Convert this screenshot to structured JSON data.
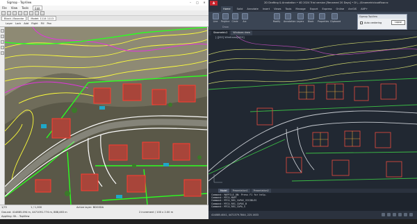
{
  "left_window": {
    "title": "Sigmap - TopView",
    "controls": [
      "–",
      "□",
      "✕"
    ],
    "menu": [
      "File",
      "View",
      "Tools"
    ],
    "menu_search": "Edit",
    "tabs": [
      "Block / Boundar",
      "Model: 1114 1113"
    ],
    "options": [
      "Layer",
      "Lock",
      "Add",
      "Right",
      "Fill",
      "Pan"
    ],
    "status_line1": "Ground: 414885.494 m, 4471091.774 m, 888,463 m",
    "status_line2": "Appliing: SIL - TopView",
    "scale_left": "1/72",
    "scale_right": "1 / 1,000",
    "layer_info": "Active layer: BDGSDA",
    "increment": "2 increment / 100 x 2.00 m"
  },
  "right_window": {
    "logo": "A",
    "title": "2D Drafting & Annotation  •  4D 2024 Trial version [Renamed 20 Days]  •  D:\\...\\Sinametricloudflow.nc",
    "ribbon_tabs": [
      "Home",
      "Solid",
      "Annotate",
      "Insert",
      "Views",
      "Tools",
      "Manage",
      "Export",
      "Express",
      "Online",
      "ArcGIS",
      "AXP+"
    ],
    "active_tab": "Home",
    "ribbon_items": [
      "Line",
      "Polyline",
      "Circle",
      "Arc",
      "Modify",
      "Annotation",
      "Layers",
      "Block",
      "Properties",
      "Clipboard"
    ],
    "ribbon_groups": [
      "Draw",
      "Properties"
    ],
    "dialog_title": "Sigmap TopView",
    "dialog_checkbox": "Auto centering",
    "dialog_button": "Lapse",
    "doc_tabs": [
      "Sinametric2",
      "Windows draw"
    ],
    "active_doc": "Sinametric2",
    "viewport_label": "[-][ISO] Wireframe[WCS]",
    "layout_tabs": [
      "Model",
      "Presentation1",
      "Presentation2"
    ],
    "active_layout": "Model",
    "command_lines": [
      "Command: MAPFILE_ON: Press F1 for help.",
      "Command: MTC4_MAPT",
      "Command: MTC4_REG_CAPAS_VISIBLES",
      "Command: MTC4_REG_CAPAS_B",
      "Command: MTC4_REG_CAPA_S"
    ],
    "status": "414885.4041, 4471379.7844, 225.1633"
  },
  "taskbar": {
    "text": ""
  },
  "colors": {
    "road": "#ffffff",
    "building": "#ff3b2f",
    "contour_yellow": "#ffff3a",
    "contour_magenta": "#e433e0",
    "vegetation": "#2cff20",
    "cad_bg": "#212832"
  }
}
